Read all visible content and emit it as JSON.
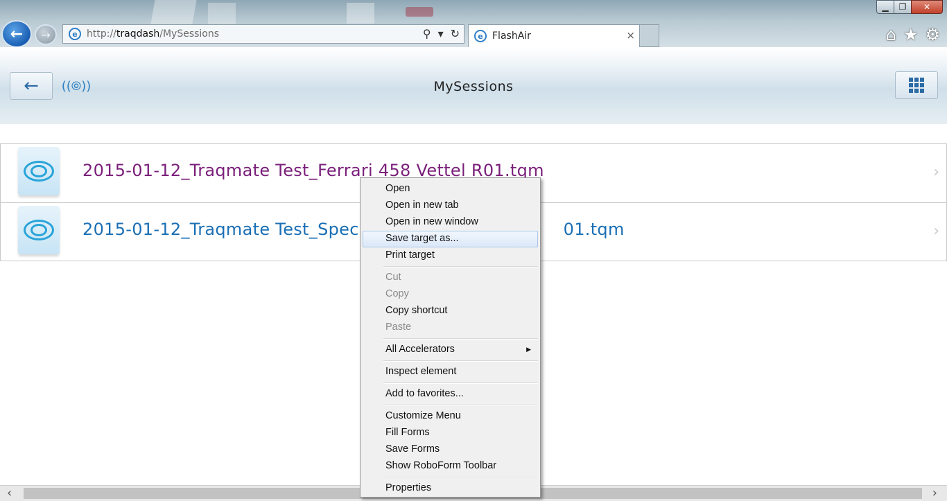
{
  "browser": {
    "back_glyph": "←",
    "forward_glyph": "→",
    "address": {
      "scheme": "http://",
      "domain": "traqdash",
      "path": "/MySessions"
    },
    "tab": {
      "title": "FlashAir",
      "close": "×"
    },
    "window_controls": {
      "minimize": "▁",
      "restore": "❐",
      "close": "✕"
    },
    "toolbar_icons": [
      "home-icon",
      "favorites-star-icon",
      "settings-gear-icon"
    ]
  },
  "header": {
    "title": "MySessions",
    "back_glyph": "←"
  },
  "files": [
    {
      "name": "2015-01-12_Traqmate Test_Ferrari 458 Vettel R01.tqm",
      "state": "visited"
    },
    {
      "name": "2015-01-12_Traqmate Test_Spec M",
      "name_tail": "01.tqm",
      "state": "link"
    }
  ],
  "context_menu": {
    "groups": [
      [
        {
          "label": "Open",
          "enabled": true
        },
        {
          "label": "Open in new tab",
          "enabled": true
        },
        {
          "label": "Open in new window",
          "enabled": true
        },
        {
          "label": "Save target as...",
          "enabled": true,
          "highlighted": true
        },
        {
          "label": "Print target",
          "enabled": true
        }
      ],
      [
        {
          "label": "Cut",
          "enabled": false
        },
        {
          "label": "Copy",
          "enabled": false
        },
        {
          "label": "Copy shortcut",
          "enabled": true
        },
        {
          "label": "Paste",
          "enabled": false
        }
      ],
      [
        {
          "label": "All Accelerators",
          "enabled": true,
          "submenu": true
        }
      ],
      [
        {
          "label": "Inspect element",
          "enabled": true
        }
      ],
      [
        {
          "label": "Add to favorites...",
          "enabled": true
        }
      ],
      [
        {
          "label": "Customize Menu",
          "enabled": true
        },
        {
          "label": "Fill Forms",
          "enabled": true
        },
        {
          "label": "Save Forms",
          "enabled": true
        },
        {
          "label": "Show RoboForm Toolbar",
          "enabled": true
        }
      ],
      [
        {
          "label": "Properties",
          "enabled": true
        }
      ]
    ]
  },
  "colors": {
    "visited_link": "#7a1f7a",
    "link": "#1a6fb5",
    "accent": "#2b6ba5"
  }
}
